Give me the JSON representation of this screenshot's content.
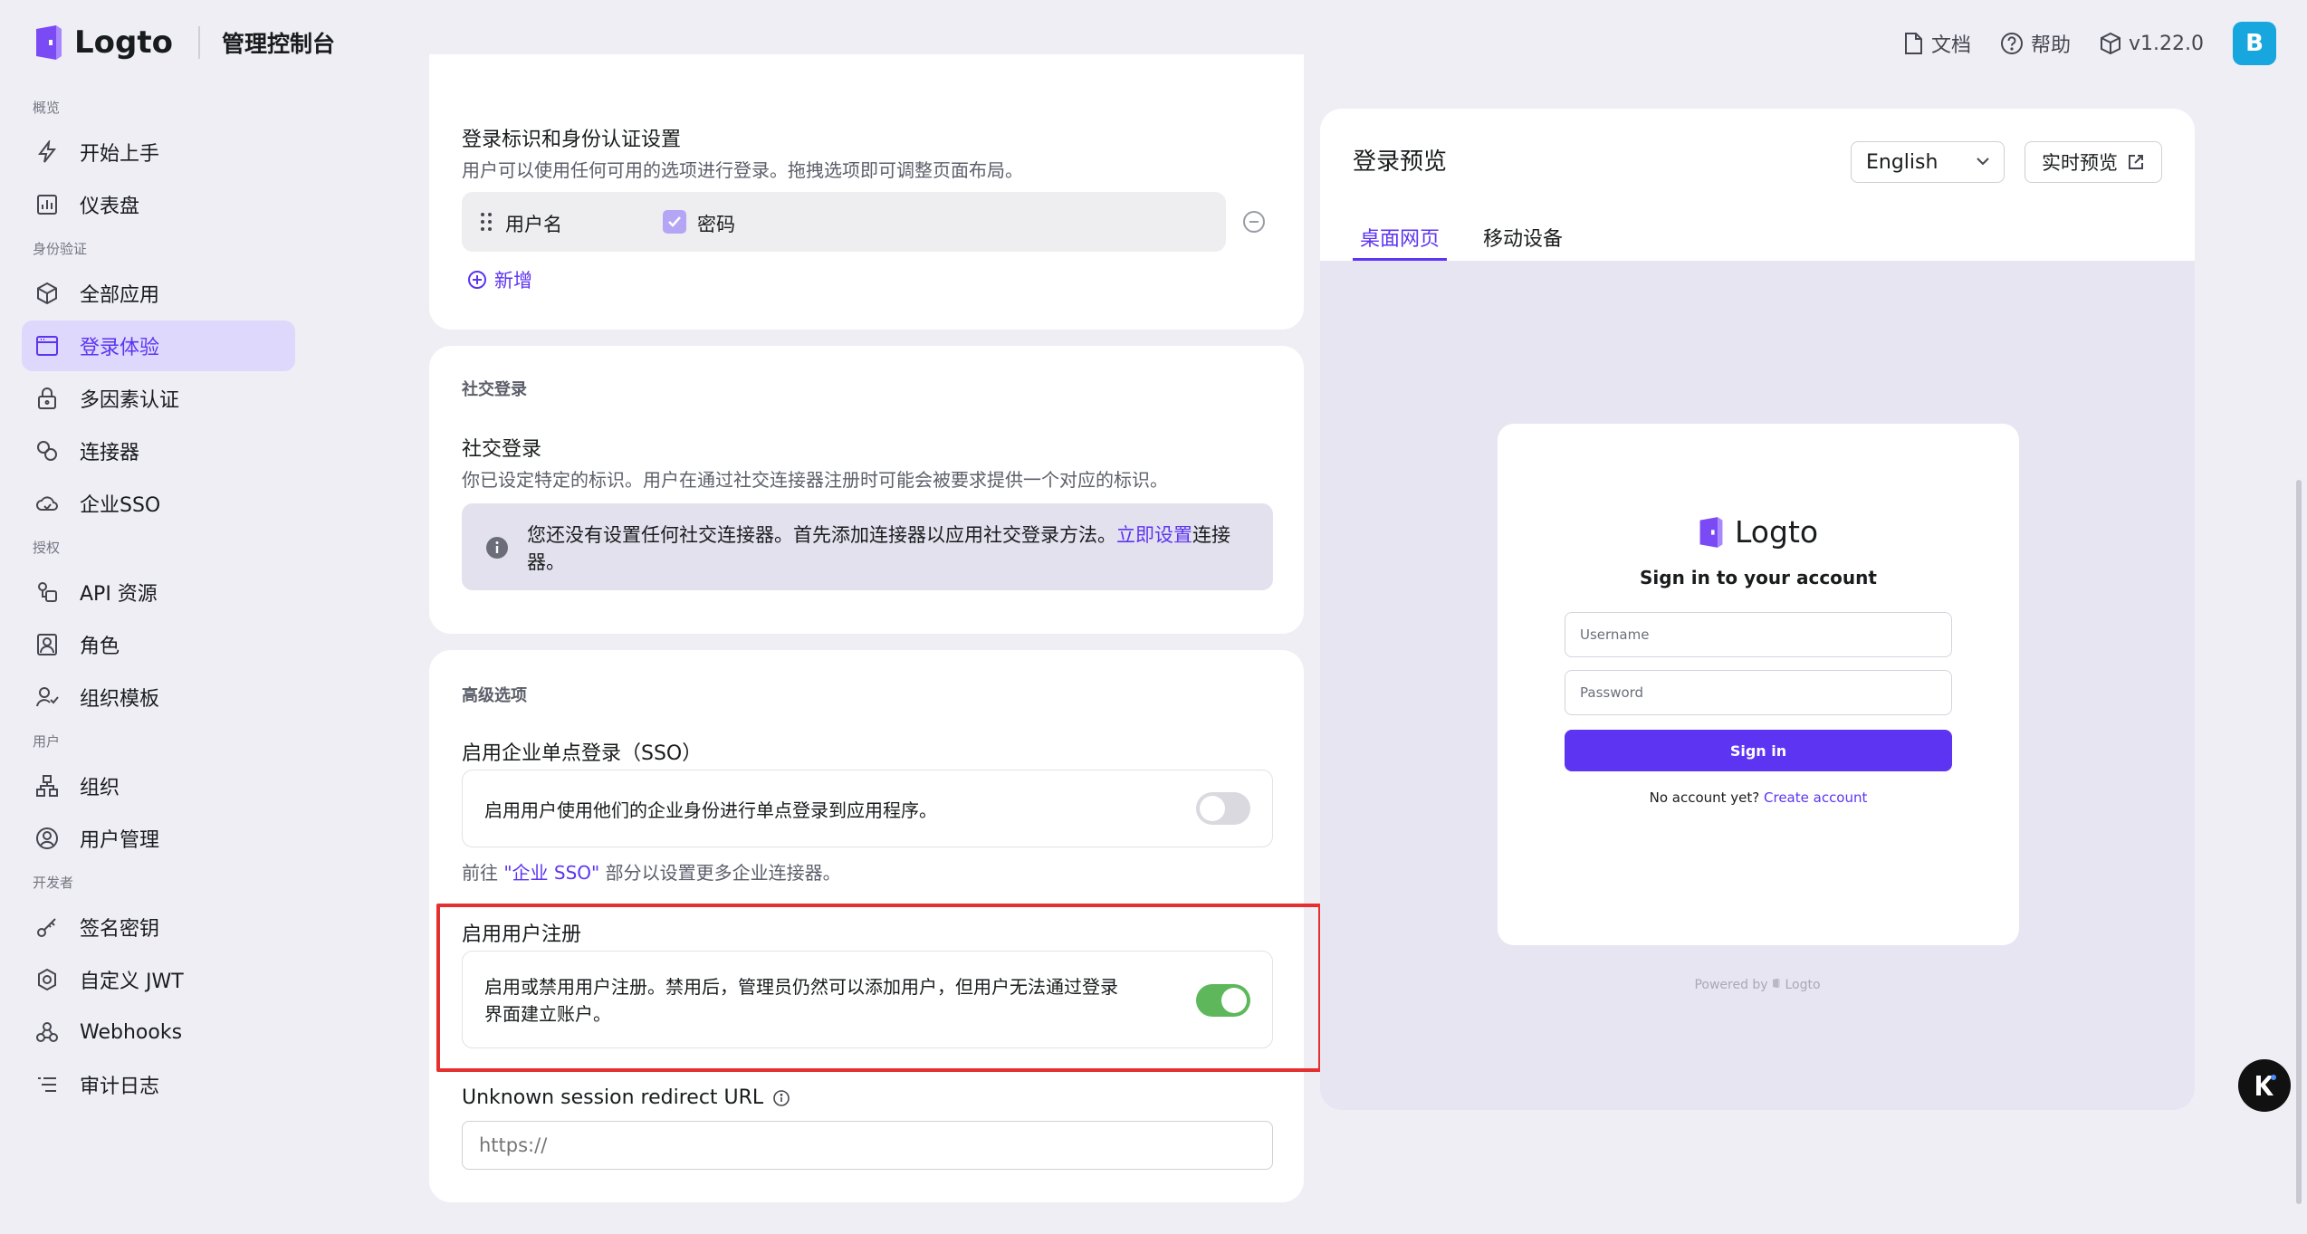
{
  "app": {
    "name": "Logto",
    "console": "管理控制台"
  },
  "topbar": {
    "docs": "文档",
    "help": "帮助",
    "version": "v1.22.0",
    "avatar": "B"
  },
  "sidebar": {
    "groups": [
      {
        "label": "概览",
        "items": [
          {
            "label": "开始上手",
            "icon": "lightning-icon"
          },
          {
            "label": "仪表盘",
            "icon": "chart-icon"
          }
        ]
      },
      {
        "label": "身份验证",
        "items": [
          {
            "label": "全部应用",
            "icon": "cube-icon"
          },
          {
            "label": "登录体验",
            "icon": "window-icon",
            "active": true
          },
          {
            "label": "多因素认证",
            "icon": "lock-icon"
          },
          {
            "label": "连接器",
            "icon": "connector-icon"
          },
          {
            "label": "企业SSO",
            "icon": "cloud-icon"
          }
        ]
      },
      {
        "label": "授权",
        "items": [
          {
            "label": "API 资源",
            "icon": "api-icon"
          },
          {
            "label": "角色",
            "icon": "role-icon"
          },
          {
            "label": "组织模板",
            "icon": "org-template-icon"
          }
        ]
      },
      {
        "label": "用户",
        "items": [
          {
            "label": "组织",
            "icon": "org-icon"
          },
          {
            "label": "用户管理",
            "icon": "user-icon"
          }
        ]
      },
      {
        "label": "开发者",
        "items": [
          {
            "label": "签名密钥",
            "icon": "key-icon"
          },
          {
            "label": "自定义 JWT",
            "icon": "gear-icon"
          },
          {
            "label": "Webhooks",
            "icon": "webhook-icon"
          },
          {
            "label": "审计日志",
            "icon": "list-icon"
          }
        ]
      }
    ]
  },
  "identifiers": {
    "title": "登录标识和身份认证设置",
    "desc": "用户可以使用任何可用的选项进行登录。拖拽选项即可调整页面布局。",
    "row_identifier": "用户名",
    "row_password": "密码",
    "add": "新增"
  },
  "social": {
    "section": "社交登录",
    "title": "社交登录",
    "desc": "你已设定特定的标识。用户在通过社交连接器注册时可能会被要求提供一个对应的标识。",
    "notice_before": "您还没有设置任何社交连接器。首先添加连接器以应用社交登录方法。",
    "notice_link": "立即设置",
    "notice_after1": "连接",
    "notice_after2": "器。"
  },
  "advanced": {
    "section": "高级选项",
    "sso_title": "启用企业单点登录（SSO）",
    "sso_desc": "启用用户使用他们的企业身份进行单点登录到应用程序。",
    "sso_enabled": false,
    "sso_hint_before": "前往 ",
    "sso_hint_link": "\"企业 SSO\"",
    "sso_hint_after": " 部分以设置更多企业连接器。",
    "reg_title": "启用用户注册",
    "reg_desc_1": "启用或禁用用户注册。禁用后，管理员仍然可以添加用户，但用户无法通过登录",
    "reg_desc_2": "界面建立账户。",
    "reg_enabled": true,
    "redirect_label": "Unknown session redirect URL",
    "redirect_placeholder": "https://"
  },
  "preview": {
    "title": "登录预览",
    "language": "English",
    "live_preview": "实时预览",
    "tabs": [
      {
        "label": "桌面网页",
        "active": true
      },
      {
        "label": "移动设备",
        "active": false
      }
    ],
    "card": {
      "brand": "Logto",
      "heading": "Sign in to your account",
      "username_placeholder": "Username",
      "password_placeholder": "Password",
      "signin": "Sign in",
      "no_account": "No account yet?",
      "create": "Create account"
    },
    "powered_by": "Powered by",
    "powered_brand": "Logto"
  },
  "colors": {
    "primary": "#5d34f2",
    "toggle_on": "#5eb85b",
    "highlight": "#e53030"
  }
}
